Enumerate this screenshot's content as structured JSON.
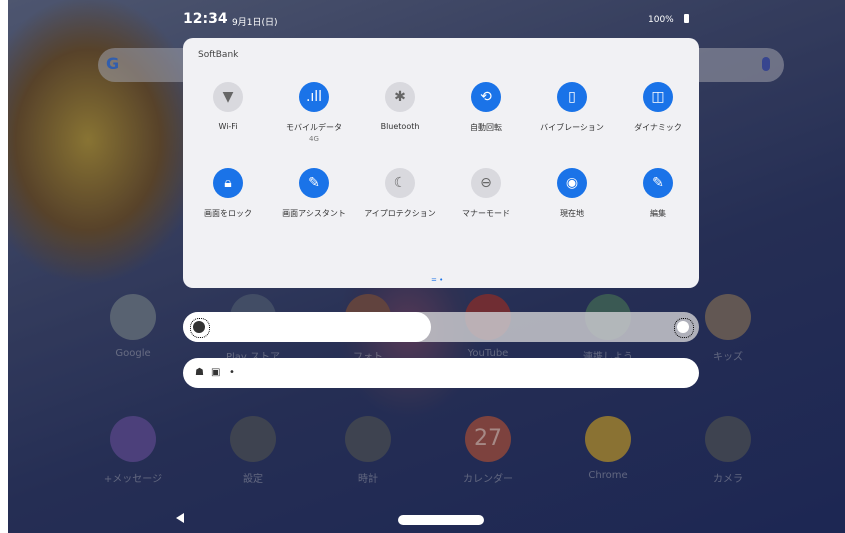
{
  "status": {
    "time": "12:34",
    "date": "9月1日(日)",
    "battery": "100%"
  },
  "quick_settings": {
    "carrier": "SoftBank",
    "tiles_row1": [
      {
        "label": "Wi-Fi",
        "sub": "",
        "icon": "wifi-icon",
        "glyph": "▼",
        "active": false
      },
      {
        "label": "モバイルデータ",
        "sub": "4G",
        "icon": "mobile-data-icon",
        "glyph": ".ıll",
        "active": true
      },
      {
        "label": "Bluetooth",
        "sub": "",
        "icon": "bluetooth-icon",
        "glyph": "✱",
        "active": false
      },
      {
        "label": "自動回転",
        "sub": "",
        "icon": "auto-rotate-icon",
        "glyph": "⟲",
        "active": true
      },
      {
        "label": "バイブレーション",
        "sub": "",
        "icon": "vibration-icon",
        "glyph": "▯",
        "active": true
      },
      {
        "label": "ダイナミック",
        "sub": "",
        "icon": "dolby-icon",
        "glyph": "◫",
        "active": true
      }
    ],
    "tiles_row2": [
      {
        "label": "画面をロック",
        "icon": "lock-icon",
        "glyph": "🔒︎",
        "active": true
      },
      {
        "label": "画面アシスタント",
        "icon": "screen-assistant-icon",
        "glyph": "✎",
        "active": true
      },
      {
        "label": "アイプロテクション",
        "icon": "eye-protection-icon",
        "glyph": "☾",
        "active": false
      },
      {
        "label": "マナーモード",
        "icon": "do-not-disturb-icon",
        "glyph": "⊖",
        "active": false
      },
      {
        "label": "現在地",
        "icon": "location-icon",
        "glyph": "◉",
        "active": true
      },
      {
        "label": "編集",
        "icon": "edit-icon",
        "glyph": "✎",
        "active": true
      }
    ],
    "pager": "= •"
  },
  "brightness": {
    "level": 0.48
  },
  "notification_row": {
    "dot": "•"
  },
  "apps_row1": [
    {
      "name": "Google",
      "color": "#7d8a99"
    },
    {
      "name": "Play ストア",
      "color": "#5b6a86"
    },
    {
      "name": "フォト",
      "color": "#8a5b4a"
    },
    {
      "name": "YouTube",
      "color": "#a23a3a"
    },
    {
      "name": "連携しよう",
      "color": "#4f7d6a"
    },
    {
      "name": "キッズ",
      "color": "#8d7a6a"
    }
  ],
  "apps_row2": [
    {
      "name": "+メッセージ",
      "color": "#6a57a8"
    },
    {
      "name": "設定",
      "color": "#555b66"
    },
    {
      "name": "時計",
      "color": "#555b66"
    },
    {
      "name": "カレンダー",
      "color": "#b55a4a",
      "badge": "27"
    },
    {
      "name": "Chrome",
      "color": "#c9a33a"
    },
    {
      "name": "カメラ",
      "color": "#555b66"
    }
  ],
  "colors": {
    "accent": "#1a73e8"
  }
}
